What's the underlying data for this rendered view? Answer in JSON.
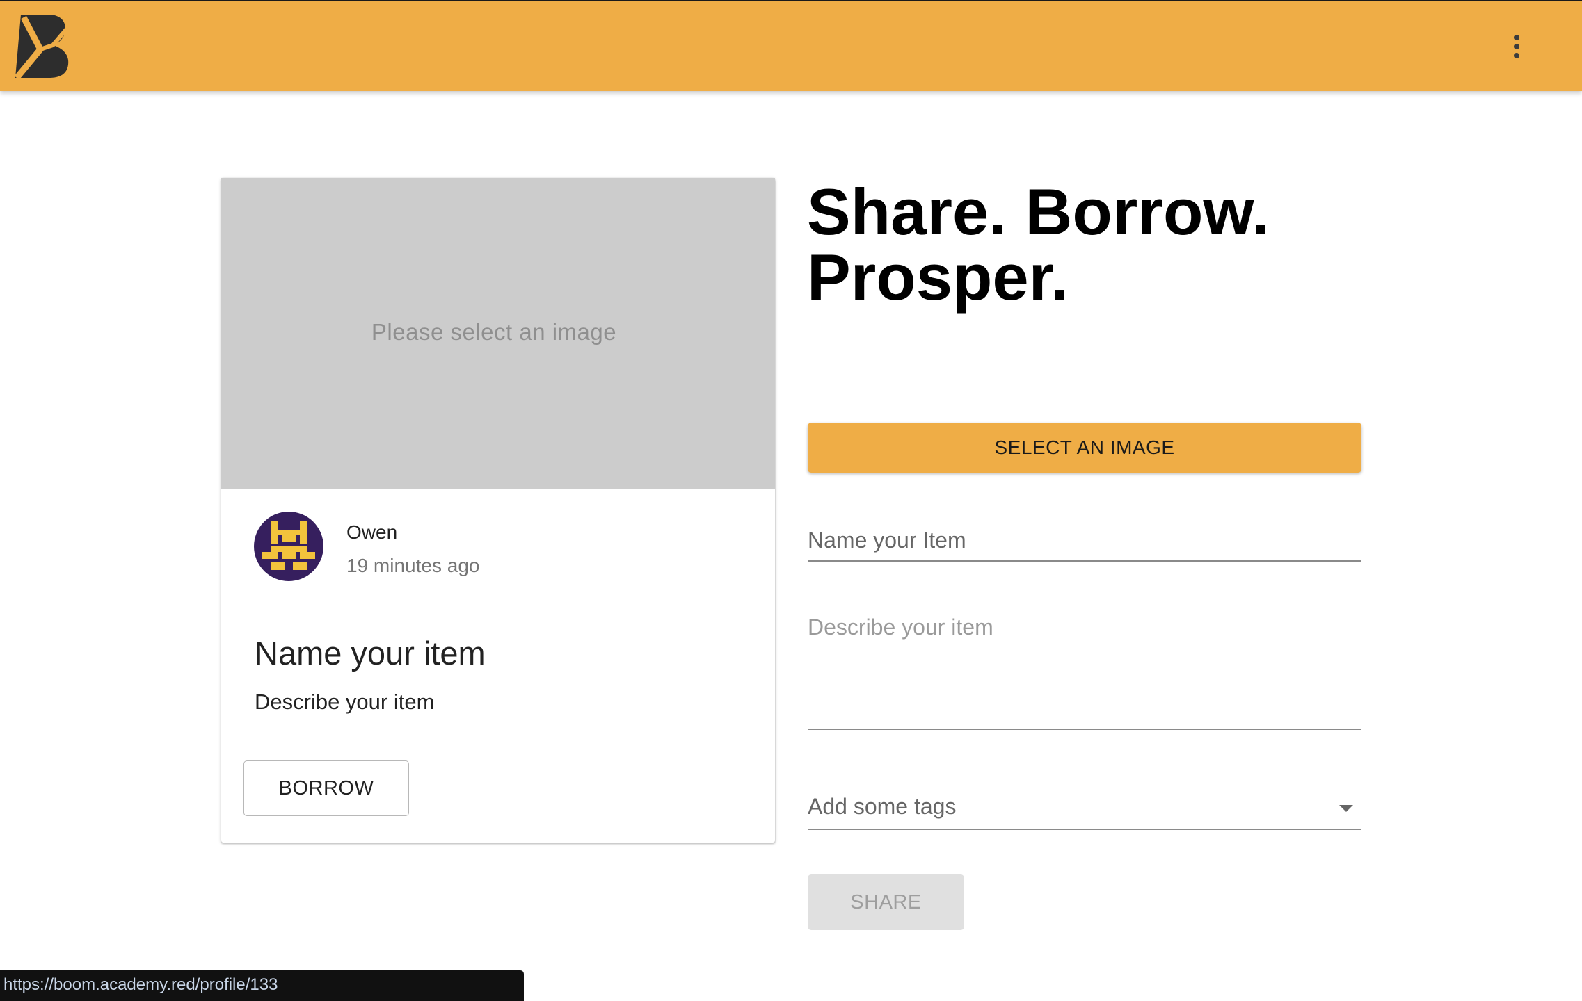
{
  "appbar": {
    "logo": "boom-logo",
    "menu_icon": "more-vert-icon",
    "color": "#efad46"
  },
  "preview_card": {
    "image_placeholder": "Please select an image",
    "owner": {
      "name": "Owen",
      "time": "19 minutes ago",
      "avatar": "pixel-avatar-icon"
    },
    "item_title": "Name your item",
    "item_description": "Describe your item",
    "borrow_label": "BORROW"
  },
  "form": {
    "headline_line1": "Share. Borrow.",
    "headline_line2": "Prosper.",
    "select_image_label": "SELECT AN IMAGE",
    "name_placeholder": "Name your Item",
    "description_placeholder": "Describe your item",
    "tags_placeholder": "Add some tags",
    "share_label": "SHARE"
  },
  "status_bar": {
    "url": "https://boom.academy.red/profile/133"
  },
  "colors": {
    "accent": "#efad46",
    "avatar_bg": "#361f5e",
    "avatar_fg": "#f2c33c"
  }
}
